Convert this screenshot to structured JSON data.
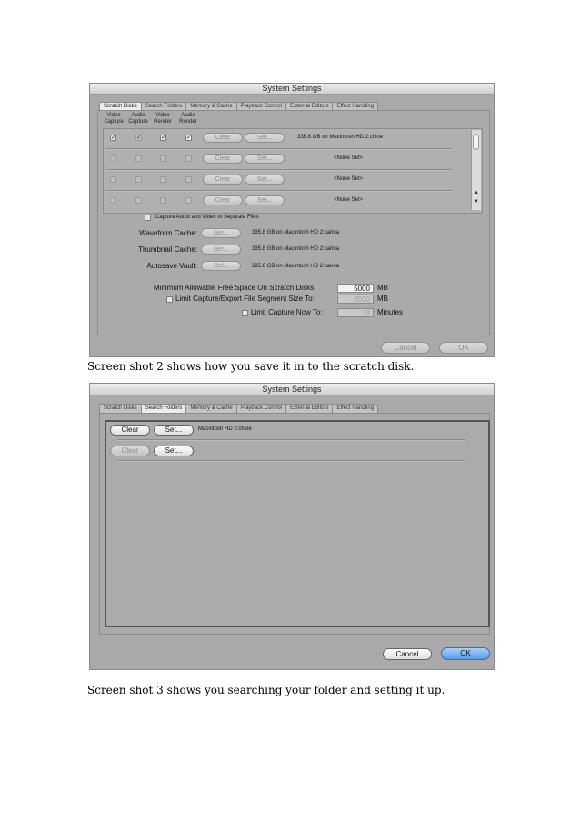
{
  "window_title": "System Settings",
  "tabs": [
    "Scratch Disks",
    "Search Folders",
    "Memory & Cache",
    "Playback Control",
    "External Editors",
    "Effect Handling"
  ],
  "shot1": {
    "column_headers": [
      {
        "line1": "Video",
        "line2": "Capture"
      },
      {
        "line1": "Audio",
        "line2": "Capture"
      },
      {
        "line1": "Video",
        "line2": "Render"
      },
      {
        "line1": "Audio",
        "line2": "Render"
      }
    ],
    "rows": [
      {
        "path": "335.8 GB on  Macintosh HD 2:chloe"
      },
      {
        "path": "<None Set>"
      },
      {
        "path": "<None Set>"
      },
      {
        "path": "<None Set>"
      }
    ],
    "clear_label": "Clear",
    "set_label": "Set...",
    "separate_files_label": "Capture Audio and Video to Separate Files",
    "caches": [
      {
        "label": "Waveform Cache:",
        "path": "335.8 GB on  Macintosh HD 2:karina"
      },
      {
        "label": "Thumbnail Cache:",
        "path": "335.8 GB on  Macintosh HD 2:karina"
      },
      {
        "label": "Autosave Vault:",
        "path": "335.8 GB on  Macintosh HD 2:karina"
      }
    ],
    "min_free_label": "Minimum Allowable Free Space On Scratch Disks:",
    "min_free_value": "5000",
    "unit_mb": "MB",
    "segment_label": "Limit Capture/Export File Segment Size To:",
    "segment_value": "2000",
    "limit_now_label": "Limit Capture Now To:",
    "limit_now_value": "30",
    "minutes_unit": "Minutes",
    "cancel_label": "Cancel",
    "ok_label": "OK"
  },
  "caption1": "Screen shot 2 shows how you save it in to the scratch disk.",
  "shot2": {
    "clear_label": "Clear",
    "set_label": "Set...",
    "folder_path": "Macintosh HD 2:chloe",
    "cancel_label": "Cancel",
    "ok_label": "OK"
  },
  "caption2": "Screen shot 3 shows you searching your folder and setting it up."
}
